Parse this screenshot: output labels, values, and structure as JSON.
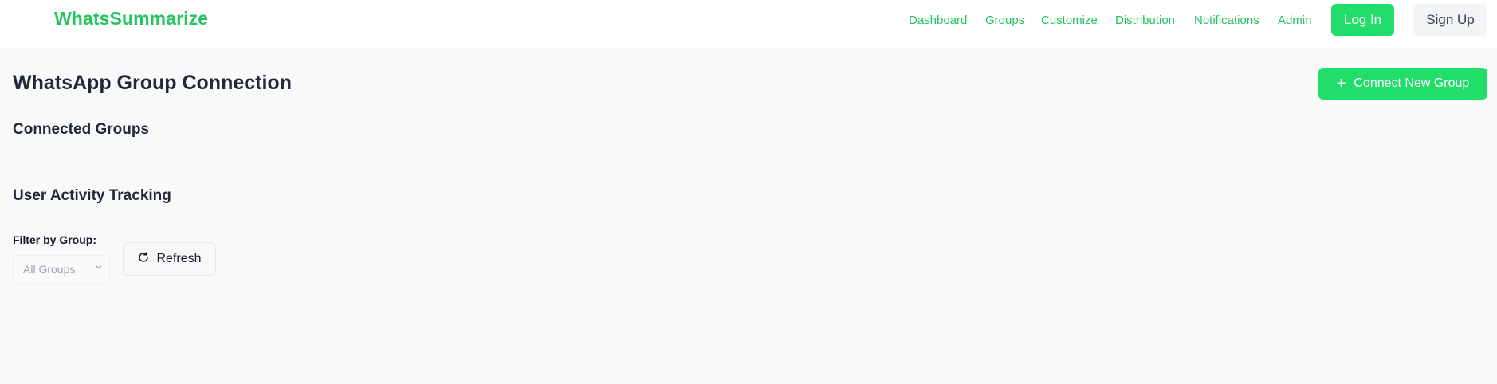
{
  "header": {
    "brand": "WhatsSummarize",
    "nav": [
      "Dashboard",
      "Groups",
      "Customize",
      "Distribution",
      "Notifications",
      "Admin"
    ],
    "login_label": "Log In",
    "signup_label": "Sign Up"
  },
  "main": {
    "title": "WhatsApp Group Connection",
    "connect_button_label": "Connect New Group",
    "connected_groups_title": "Connected Groups",
    "activity_title": "User Activity Tracking",
    "filter_label": "Filter by Group:",
    "filter_value": "All Groups",
    "refresh_label": "Refresh"
  },
  "icons": {
    "connect": "plus-icon",
    "refresh": "refresh-icon",
    "select": "chevron-down-icon"
  },
  "colors": {
    "accent": "#22dd6a",
    "brand": "#22c55e",
    "background": "#f9f9f9"
  }
}
